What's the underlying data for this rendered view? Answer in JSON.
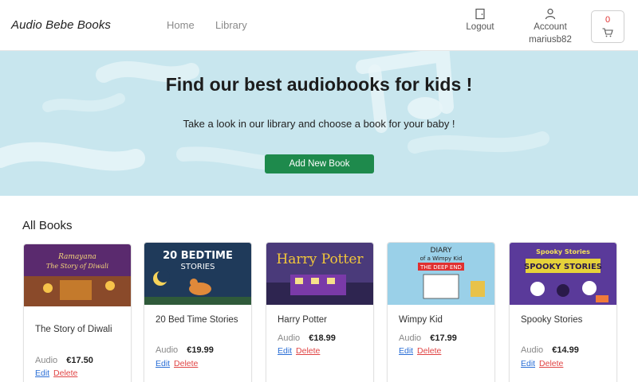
{
  "navbar": {
    "brand": "Audio Bebe Books",
    "links": [
      "Home",
      "Library"
    ],
    "logout_label": "Logout",
    "account_label": "Account",
    "username": "mariusb82",
    "cart_count": "0"
  },
  "hero": {
    "title": "Find our best audiobooks for kids !",
    "subtitle": "Take a look in our library and choose a book for your baby !",
    "add_button": "Add New Book"
  },
  "books_section": {
    "title": "All Books",
    "edit_label": "Edit",
    "delete_label": "Delete",
    "books": [
      {
        "title": "The Story of Diwali",
        "format": "Audio",
        "price": "€17.50",
        "cover_text": "Ramayana The Story of Diwali"
      },
      {
        "title": "20 Bed Time Stories",
        "format": "Audio",
        "price": "€19.99",
        "cover_text": "20 BEDTIME STORIES"
      },
      {
        "title": "Harry Potter",
        "format": "Audio",
        "price": "€18.99",
        "cover_text": "Harry Potter"
      },
      {
        "title": "Wimpy Kid",
        "format": "Audio",
        "price": "€17.99",
        "cover_text": "DIARY of a Wimpy Kid THE DEEP END"
      },
      {
        "title": "Spooky Stories",
        "format": "Audio",
        "price": "€14.99",
        "cover_text": "Spooky Stories"
      }
    ]
  },
  "colors": {
    "hero_bg": "#c8e6ee",
    "primary_button": "#1e8a4c",
    "edit_link": "#2b6fd6",
    "delete_link": "#e04444",
    "cart_count": "#e03131"
  }
}
